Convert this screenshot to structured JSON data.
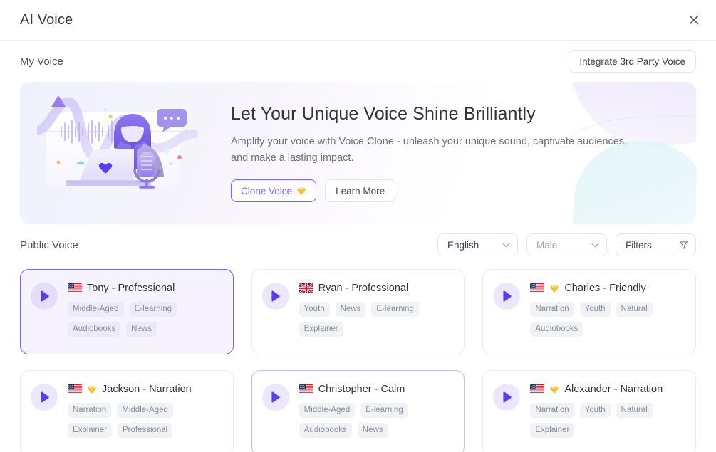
{
  "window": {
    "title": "AI Voice",
    "close_icon": "close-icon"
  },
  "my_voice": {
    "section_title": "My Voice",
    "integrate_button": "Integrate 3rd Party Voice",
    "banner": {
      "heading": "Let Your Unique Voice Shine Brilliantly",
      "description": "Amplify your voice with Voice Clone - unleash your unique sound, captivate audiences, and make a lasting impact.",
      "primary_button": "Clone Voice",
      "primary_button_icon": "gem-icon",
      "secondary_button": "Learn More",
      "illustration_icon": "voice-clone-illustration"
    }
  },
  "public_voice": {
    "section_title": "Public Voice",
    "filters": {
      "language": {
        "value": "English",
        "icon": "chevron-down-icon"
      },
      "gender": {
        "value": "Male",
        "icon": "chevron-down-icon",
        "is_placeholder": true
      },
      "filters_button": {
        "label": "Filters",
        "icon": "filter-icon"
      }
    },
    "cards": [
      {
        "name": "Tony - Professional",
        "flag": "us-flag-icon",
        "premium": false,
        "selected": true,
        "hovered": false,
        "play_icon": "play-icon",
        "tags": [
          "Middle-Aged",
          "E-learning",
          "Audiobooks",
          "News"
        ]
      },
      {
        "name": "Ryan - Professional",
        "flag": "uk-flag-icon",
        "premium": false,
        "selected": false,
        "hovered": false,
        "play_icon": "play-icon",
        "tags": [
          "Youth",
          "News",
          "E-learning",
          "Explainer"
        ]
      },
      {
        "name": "Charles - Friendly",
        "flag": "us-flag-icon",
        "premium": true,
        "selected": false,
        "hovered": false,
        "play_icon": "play-icon",
        "tags": [
          "Narration",
          "Youth",
          "Natural",
          "Audiobooks"
        ]
      },
      {
        "name": "Jackson - Narration",
        "flag": "us-flag-icon",
        "premium": true,
        "selected": false,
        "hovered": false,
        "play_icon": "play-icon",
        "tags": [
          "Narration",
          "Middle-Aged",
          "Explainer",
          "Professional"
        ]
      },
      {
        "name": "Christopher - Calm",
        "flag": "us-flag-icon",
        "premium": false,
        "selected": false,
        "hovered": true,
        "play_icon": "play-icon",
        "tags": [
          "Middle-Aged",
          "E-learning",
          "Audiobooks",
          "News"
        ]
      },
      {
        "name": "Alexander - Narration",
        "flag": "us-flag-icon",
        "premium": true,
        "selected": false,
        "hovered": false,
        "play_icon": "play-icon",
        "tags": [
          "Narration",
          "Youth",
          "Natural",
          "Explainer"
        ]
      }
    ]
  },
  "colors": {
    "accent": "#7b61f2",
    "play_purple": "#5b3df0",
    "premium_gem": "#f5c542",
    "text_primary": "#2f3440",
    "text_muted": "#878e9c"
  }
}
